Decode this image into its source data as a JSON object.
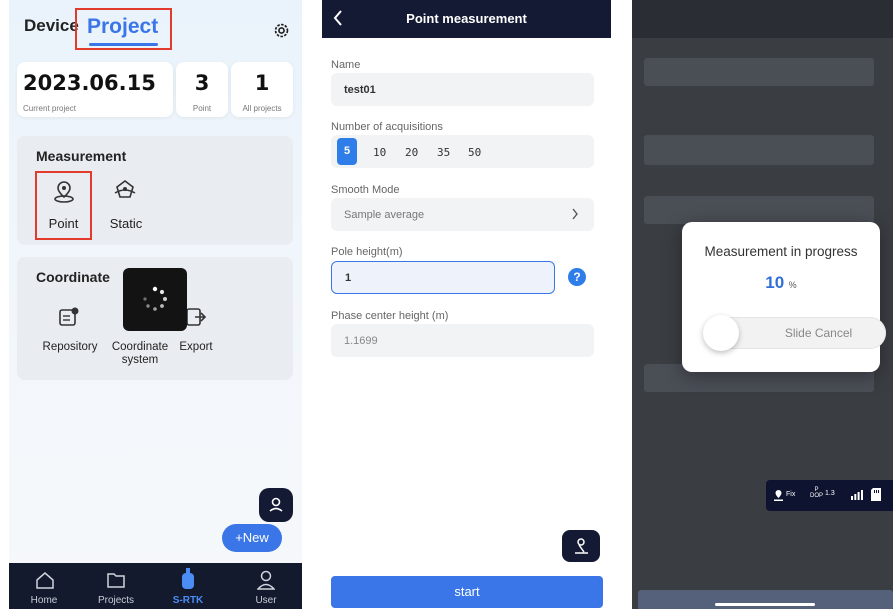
{
  "home": {
    "tab_device": "Device",
    "tab_project": "Project",
    "date": "2023.06.15",
    "current_project_label": "Current project",
    "point_count": "3",
    "point_label": "Point",
    "projects_count": "1",
    "projects_label": "All projects",
    "measurement_title": "Measurement",
    "point_tool": "Point",
    "static_tool": "Static",
    "coordinate_title": "Coordinate",
    "repository": "Repository",
    "coord_line1": "Coordinate",
    "coord_line2": "system",
    "export": "Export",
    "new_button": "+New",
    "nav": [
      "Home",
      "Projects",
      "S-RTK",
      "User"
    ]
  },
  "point_form": {
    "title": "Point measurement",
    "name_label": "Name",
    "name_value": "test01",
    "acq_label": "Number of acquisitions",
    "acq_options": [
      "5",
      "10",
      "20",
      "35",
      "50"
    ],
    "acq_selected": "5",
    "smooth_label": "Smooth Mode",
    "smooth_value": "Sample average",
    "pole_label": "Pole height(m)",
    "pole_value": "1",
    "phase_label": "Phase center height (m)",
    "phase_value": "1.1699",
    "start_button": "start"
  },
  "progress_dialog": {
    "title": "Measurement in progress",
    "percent": "10",
    "percent_unit": "%",
    "progress_fraction": 0.1,
    "slide_text": "Slide Cancel",
    "status_fix": "Fix",
    "status_dop_top": "P",
    "status_dop_bottom": "DOP",
    "status_dop_value": "1.3"
  },
  "colors": {
    "accent": "#3b76e8",
    "highlight_box": "#e23b2e",
    "dark_bar": "#141a33"
  }
}
